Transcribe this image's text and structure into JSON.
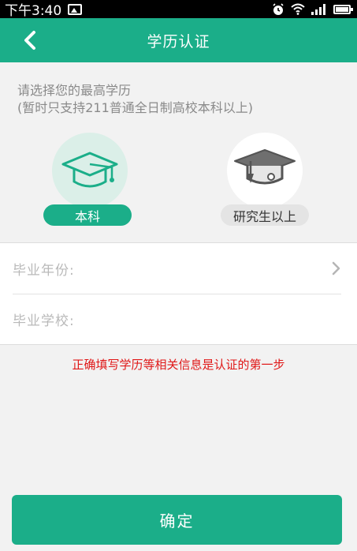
{
  "status_bar": {
    "time": "下午3:40"
  },
  "header": {
    "title": "学历认证"
  },
  "hint": {
    "line1": "请选择您的最高学历",
    "line2": "(暂时只支持211普通全日制高校本科以上)"
  },
  "degree_options": [
    {
      "label": "本科",
      "selected": true
    },
    {
      "label": "研究生以上",
      "selected": false
    }
  ],
  "form": {
    "graduation_year_label": "毕业年份:",
    "school_label": "毕业学校:"
  },
  "notice": "正确填写学历等相关信息是认证的第一步",
  "confirm_label": "确定",
  "colors": {
    "accent": "#1bae89",
    "notice": "#e01818"
  }
}
